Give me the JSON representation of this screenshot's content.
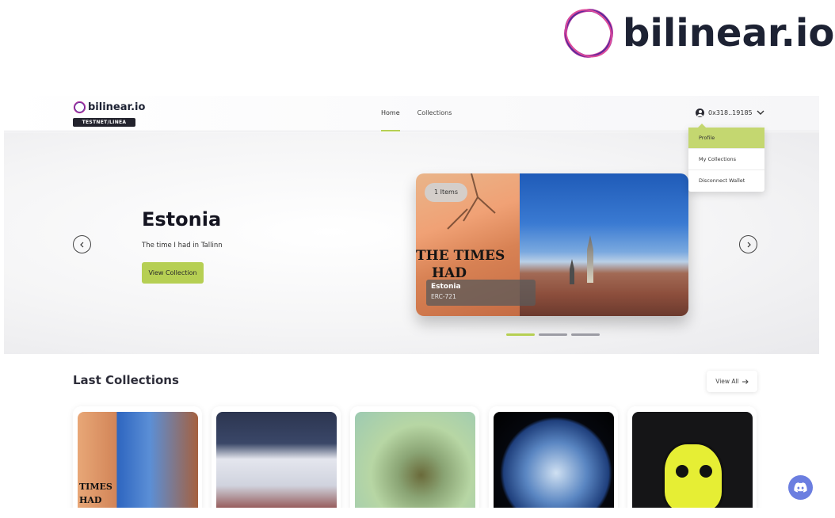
{
  "brand": {
    "name": "bilinear.io",
    "logo_color_a": "#d13aa0",
    "logo_color_b": "#5a2a9a"
  },
  "header": {
    "logo_text": "bilinear.io",
    "network_badge": "TESTNET/LINEA",
    "nav": [
      {
        "label": "Home",
        "active": true
      },
      {
        "label": "Collections",
        "active": false
      }
    ],
    "wallet_address": "0x318..19185"
  },
  "dropdown": {
    "items": [
      {
        "label": "Profile",
        "active": true
      },
      {
        "label": "My Collections"
      },
      {
        "label": "Disconnect Wallet"
      }
    ]
  },
  "hero": {
    "title": "Estonia",
    "subtitle": "The time I had in Tallinn",
    "button_label": "View Collection",
    "card": {
      "items_pill": "1 Items",
      "name": "Estonia",
      "standard": "ERC-721",
      "graffiti_line1": "THE TIMES",
      "graffiti_line2": "HAD"
    },
    "slides": 3,
    "active_slide": 0
  },
  "collections": {
    "title": "Last Collections",
    "view_all_label": "View All",
    "tiles": [
      {
        "name": "tile-estonia",
        "overlay_text": "TIMES\nHAD"
      },
      {
        "name": "tile-venice"
      },
      {
        "name": "tile-tree"
      },
      {
        "name": "tile-earth"
      },
      {
        "name": "tile-ape"
      }
    ]
  },
  "colors": {
    "accent": "#b6cf53",
    "dropdown_active": "#c4d770",
    "discord": "#6b7ee0"
  }
}
